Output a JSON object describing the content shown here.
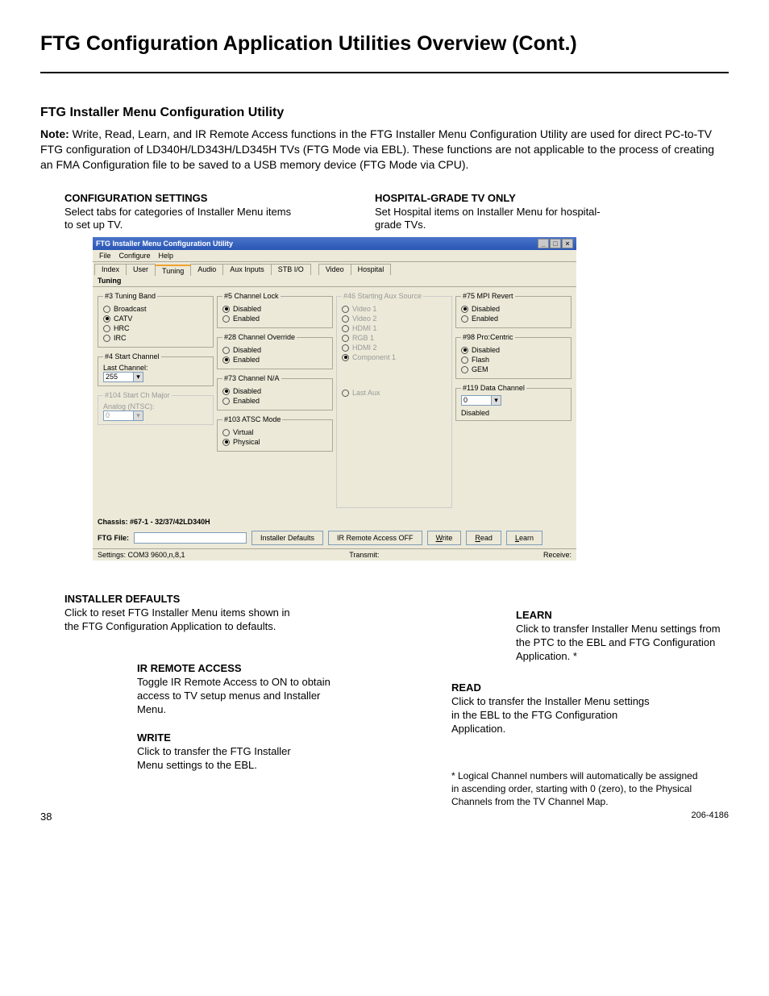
{
  "page": {
    "title": "FTG Configuration Application Utilities Overview (Cont.)",
    "section_heading": "FTG Installer Menu Configuration Utility",
    "note_label": "Note:",
    "note_text": " Write, Read, Learn, and IR Remote Access functions in the FTG Installer Menu Configuration Utility are used for direct PC-to-TV FTG configuration of LD340H/LD343H/LD345H TVs (FTG Mode via EBL). These functions are not applicable to the process of creating an FMA Configuration file to be saved to a USB memory device (FTG Mode via CPU).",
    "page_number": "38",
    "doc_number": "206-4186"
  },
  "top_callouts": {
    "config": {
      "hd": "CONFIGURATION SETTINGS",
      "body": "Select tabs for categories of Installer Menu items to set up TV."
    },
    "hospital": {
      "hd": "HOSPITAL-GRADE TV ONLY",
      "body": "Set Hospital items on Installer Menu for hospital-grade TVs."
    }
  },
  "app": {
    "title": "FTG Installer Menu Configuration Utility",
    "menu": {
      "file": "File",
      "configure": "Configure",
      "help": "Help"
    },
    "tabs": {
      "index": "Index",
      "user": "User",
      "tuning": "Tuning",
      "audio": "Audio",
      "aux": "Aux Inputs",
      "stb": "STB I/O",
      "video": "Video",
      "hospital": "Hospital"
    },
    "panel_label": "Tuning",
    "groups": {
      "tuning_band": {
        "legend": "#3 Tuning Band",
        "broadcast": "Broadcast",
        "catv": "CATV",
        "hrc": "HRC",
        "irc": "IRC"
      },
      "start_channel": {
        "legend": "#4 Start Channel",
        "label": "Last Channel:",
        "value": "255"
      },
      "start_ch_major": {
        "legend": "#104 Start Ch Major",
        "label": "Analog (NTSC):",
        "value": "0"
      },
      "channel_lock": {
        "legend": "#5 Channel Lock",
        "disabled": "Disabled",
        "enabled": "Enabled"
      },
      "channel_override": {
        "legend": "#28 Channel Override",
        "disabled": "Disabled",
        "enabled": "Enabled"
      },
      "channel_na": {
        "legend": "#73 Channel N/A",
        "disabled": "Disabled",
        "enabled": "Enabled"
      },
      "atsc_mode": {
        "legend": "#103 ATSC Mode",
        "virtual": "Virtual",
        "physical": "Physical"
      },
      "starting_aux": {
        "legend": "#46 Starting Aux Source",
        "video1": "Video 1",
        "video2": "Video 2",
        "hdmi1": "HDMI 1",
        "rgb1": "RGB 1",
        "hdmi2": "HDMI 2",
        "component1": "Component 1",
        "lastaux": "Last Aux"
      },
      "mpi_revert": {
        "legend": "#75 MPI Revert",
        "disabled": "Disabled",
        "enabled": "Enabled"
      },
      "procentric": {
        "legend": "#98 Pro:Centric",
        "disabled": "Disabled",
        "flash": "Flash",
        "gem": "GEM"
      },
      "data_channel": {
        "legend": "#119 Data Channel",
        "value": "0",
        "status": "Disabled"
      }
    },
    "chassis_label": "Chassis:",
    "chassis_value": "#67-1 - 32/37/42LD340H",
    "ftg_file_label": "FTG File:",
    "settings": "Settings: COM3 9600,n,8,1",
    "transmit": "Transmit:",
    "receive": "Receive:",
    "buttons": {
      "installer_defaults": "Installer Defaults",
      "ir_remote": "IR Remote Access OFF",
      "write": "Write",
      "read": "Read",
      "learn": "Learn"
    }
  },
  "bottom_callouts": {
    "installer_defaults": {
      "hd": "INSTALLER DEFAULTS",
      "body": "Click to reset FTG Installer Menu items shown in the FTG Configuration Application to defaults."
    },
    "ir_remote": {
      "hd": "IR REMOTE ACCESS",
      "body": "Toggle IR Remote Access to ON to obtain access to TV setup menus and Installer Menu."
    },
    "write": {
      "hd": "WRITE",
      "body": "Click to transfer the FTG Installer Menu settings to the EBL."
    },
    "learn": {
      "hd": "LEARN",
      "body": "Click to transfer Installer Menu settings from the PTC to the EBL and FTG Configuration Application. *"
    },
    "read": {
      "hd": "READ",
      "body": "Click to transfer the Installer Menu settings in the EBL to the FTG Configuration Application."
    },
    "footnote": "* Logical Channel numbers will automatically be assigned in ascending order, starting with 0 (zero), to the Physical Channels from the TV Channel Map."
  }
}
